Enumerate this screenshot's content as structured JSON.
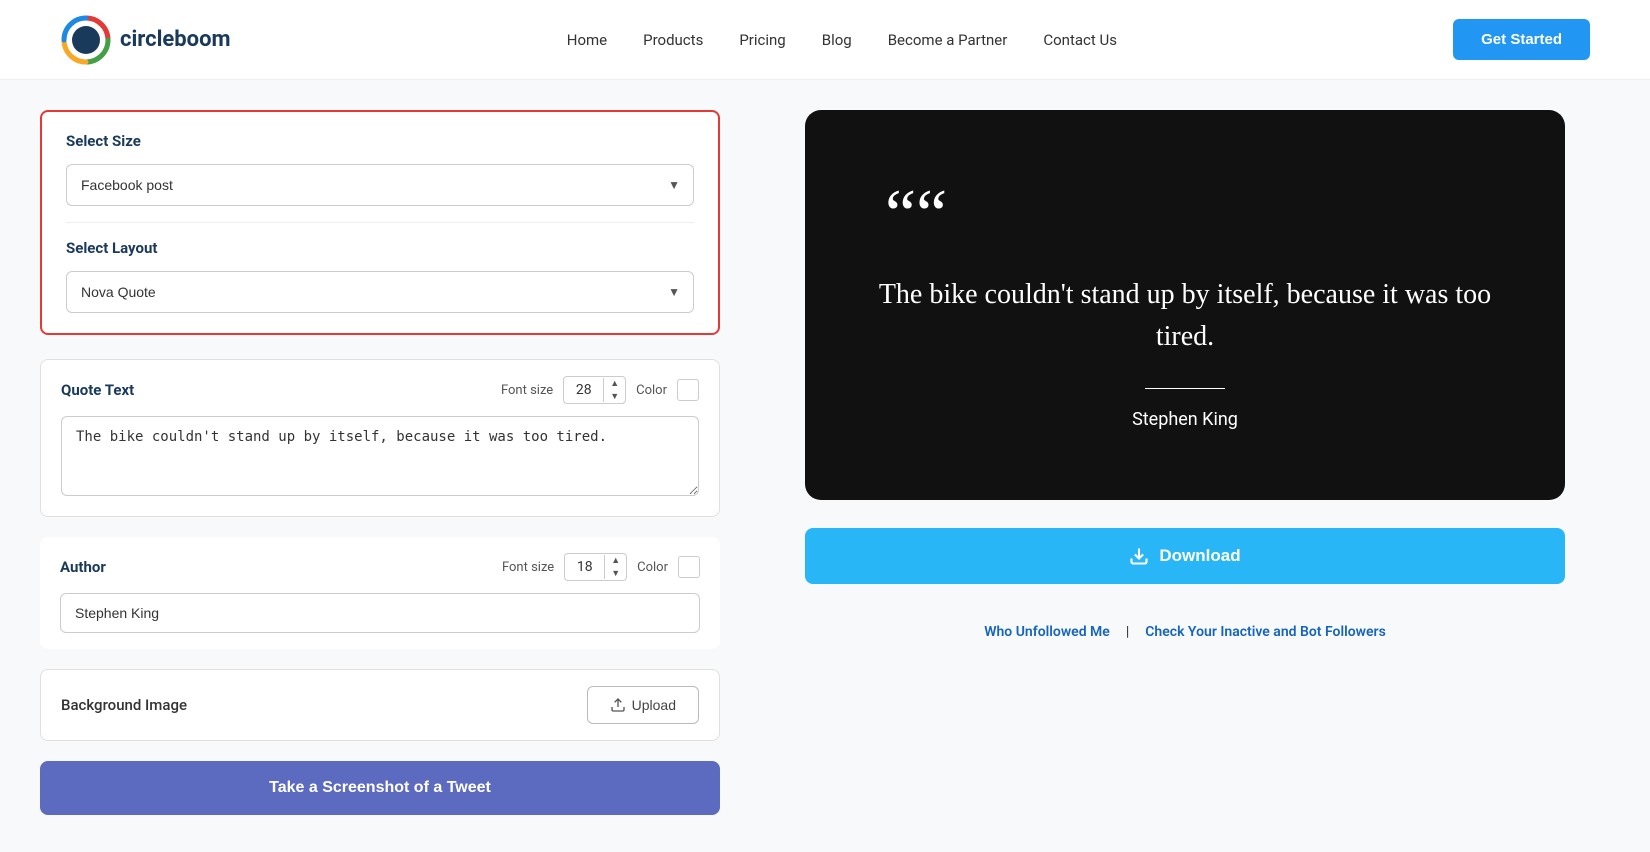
{
  "header": {
    "logo_text": "circleboom",
    "nav": {
      "home": "Home",
      "products": "Products",
      "pricing": "Pricing",
      "blog": "Blog",
      "partner": "Become a Partner",
      "contact": "Contact Us"
    },
    "cta_button": "Get Started"
  },
  "left": {
    "select_size_label": "Select Size",
    "size_option": "Facebook post",
    "select_layout_label": "Select Layout",
    "layout_option": "Nova Quote",
    "quote_text_label": "Quote Text",
    "font_size_label": "Font size",
    "quote_font_size": "28",
    "color_label": "Color",
    "quote_text_value": "The bike couldn't stand up by itself, because it was too tired.",
    "author_label": "Author",
    "author_font_size": "18",
    "author_value": "Stephen King",
    "bg_image_label": "Background Image",
    "upload_label": "Upload",
    "screenshot_btn": "Take a Screenshot of a Tweet"
  },
  "right": {
    "quote_mark": "““",
    "quote_text": "The bike couldn't stand up by itself, because it was too tired.",
    "author": "Stephen King",
    "download_label": "Download"
  },
  "footer": {
    "link1": "Who Unfollowed Me",
    "separator": "|",
    "link2": "Check Your Inactive and Bot Followers"
  }
}
